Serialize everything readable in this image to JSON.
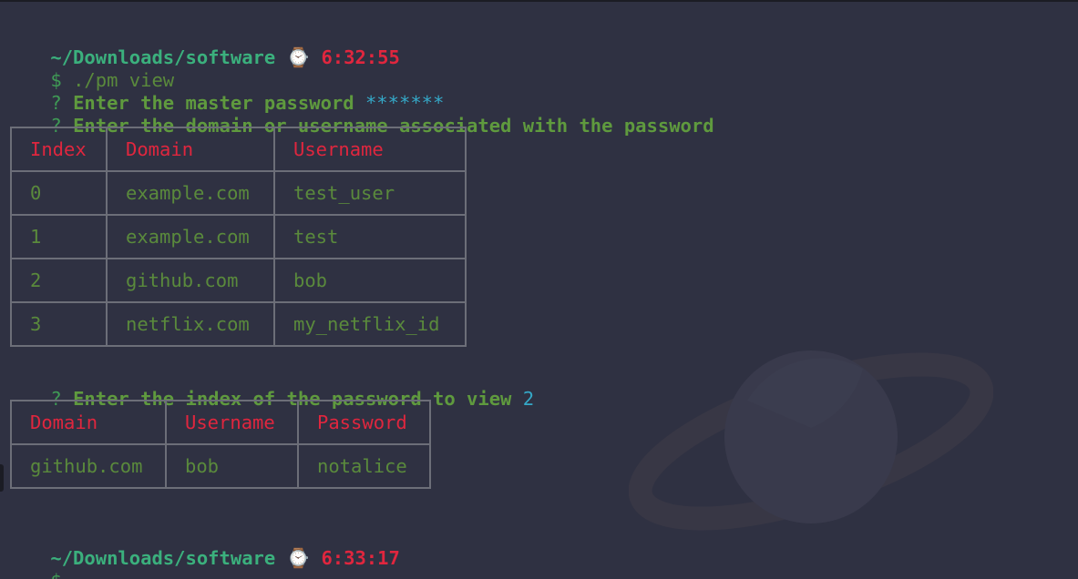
{
  "session": {
    "first_prompt": {
      "path": "~/Downloads/software",
      "watch": "⌚",
      "time": "6:32:55"
    },
    "command": {
      "symbol": "$",
      "text": "./pm view"
    },
    "master_password_prompt": {
      "marker": "?",
      "label": "Enter the master password",
      "value": "*******"
    },
    "domain_prompt": {
      "marker": "?",
      "label": "Enter the domain or username associated with the password"
    },
    "results_table": {
      "headers": [
        "Index",
        "Domain",
        "Username"
      ],
      "rows": [
        [
          "0",
          "example.com",
          "test_user"
        ],
        [
          "1",
          "example.com",
          "test"
        ],
        [
          "2",
          "github.com",
          "bob"
        ],
        [
          "3",
          "netflix.com",
          "my_netflix_id"
        ]
      ]
    },
    "index_prompt": {
      "marker": "?",
      "label": "Enter the index of the password to view",
      "value": "2"
    },
    "password_table": {
      "headers": [
        "Domain",
        "Username",
        "Password"
      ],
      "rows": [
        [
          "github.com",
          "bob",
          "notalice"
        ]
      ]
    },
    "second_prompt": {
      "path": "~/Downloads/software",
      "watch": "⌚",
      "time": "6:33:17"
    },
    "final_line": {
      "symbol": "$",
      "cursor": "_"
    }
  },
  "colors": {
    "background": "#2f3142",
    "path": "#3bb07d",
    "time": "#e0263e",
    "text_green": "#5a8a3c",
    "answer_cyan": "#35a8c7",
    "table_header": "#e0263e",
    "table_border": "#6c6e78"
  }
}
